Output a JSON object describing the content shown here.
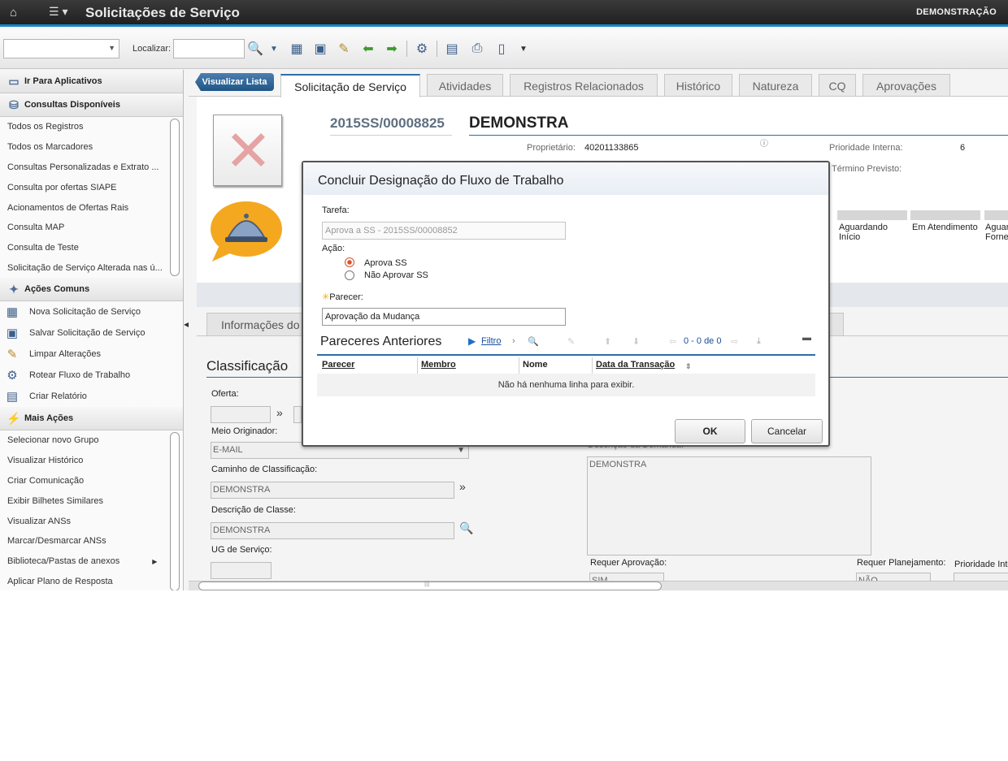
{
  "app": {
    "title": "Solicitações de Serviço",
    "environment": "DEMONSTRAÇÃO"
  },
  "toolbar": {
    "find_label": "Localizar:"
  },
  "sidebar": {
    "go_to_apps": "Ir Para Aplicativos",
    "queries_header": "Consultas Disponíveis",
    "queries": [
      "Todos os Registros",
      "Todos os Marcadores",
      "Consultas Personalizadas e Extrato ...",
      "Consulta por ofertas SIAPE",
      "Acionamentos de Ofertas Rais",
      "Consulta MAP",
      "Consulta de Teste",
      "Solicitação de Serviço Alterada nas ú..."
    ],
    "common_header": "Ações Comuns",
    "common_actions": [
      "Nova Solicitação de Serviço",
      "Salvar Solicitação de Serviço",
      "Limpar Alterações",
      "Rotear Fluxo de Trabalho",
      "Criar Relatório"
    ],
    "more_header": "Mais Ações",
    "more_actions": [
      "Selecionar novo Grupo",
      "Visualizar Histórico",
      "Criar Comunicação",
      "Exibir Bilhetes Similares",
      "Visualizar ANSs",
      "Marcar/Desmarcar ANSs",
      "Biblioteca/Pastas de anexos",
      "Aplicar Plano de Resposta"
    ]
  },
  "tabs": {
    "back_button": "Visualizar Lista",
    "items": [
      "Solicitação de Serviço",
      "Atividades",
      "Registros Relacionados",
      "Histórico",
      "Natureza",
      "CQ",
      "Aprovações"
    ]
  },
  "record": {
    "id": "2015SS/00008825",
    "name": "DEMONSTRA",
    "owner_label": "Proprietário:",
    "owner": "40201133865",
    "priority_label": "Prioridade Interna:",
    "priority": "6",
    "end_label": "Término Previsto:",
    "statuses": [
      "Aguardando Início",
      "Em Atendimento",
      "Aguar Forne"
    ]
  },
  "subtabs": {
    "info": "Informações do"
  },
  "classification": {
    "title": "Classificação",
    "offer_label": "Oferta:",
    "origin_label": "Meio Originador:",
    "origin": "E-MAIL",
    "path_label": "Caminho de Classificação:",
    "path": "DEMONSTRA",
    "class_desc_label": "Descrição de Classe:",
    "class_desc": "DEMONSTRA",
    "ug_label": "UG de Serviço:",
    "demand_label": "Descrição da Demanda:",
    "demand": "DEMONSTRA",
    "requires_approval_label": "Requer Aprovação:",
    "requires_approval": "SIM",
    "requires_planning_label": "Requer Planejamento:",
    "requires_planning": "NÃO",
    "priority_label": "Prioridade Inte"
  },
  "dialog": {
    "title": "Concluir Designação do Fluxo de Trabalho",
    "task_label": "Tarefa:",
    "task": "Aprova a SS - 2015SS/00008852",
    "action_label": "Ação:",
    "options": [
      "Aprova SS",
      "Não Aprovar SS"
    ],
    "selected_option": 0,
    "opinion_label": "Parecer:",
    "opinion": "Aprovação da Mudança",
    "previous_title": "Pareceres Anteriores",
    "filter": "Filtro",
    "pagination": "0 - 0 de 0",
    "columns": [
      "Parecer",
      "Membro",
      "Nome",
      "Data da Transação"
    ],
    "empty": "Não há nenhuma linha para exibir.",
    "ok": "OK",
    "cancel": "Cancelar"
  },
  "colors": {
    "accent": "#2f6ea4",
    "topbar_border": "#1b87c9",
    "radio_selected": "#e0502a"
  }
}
